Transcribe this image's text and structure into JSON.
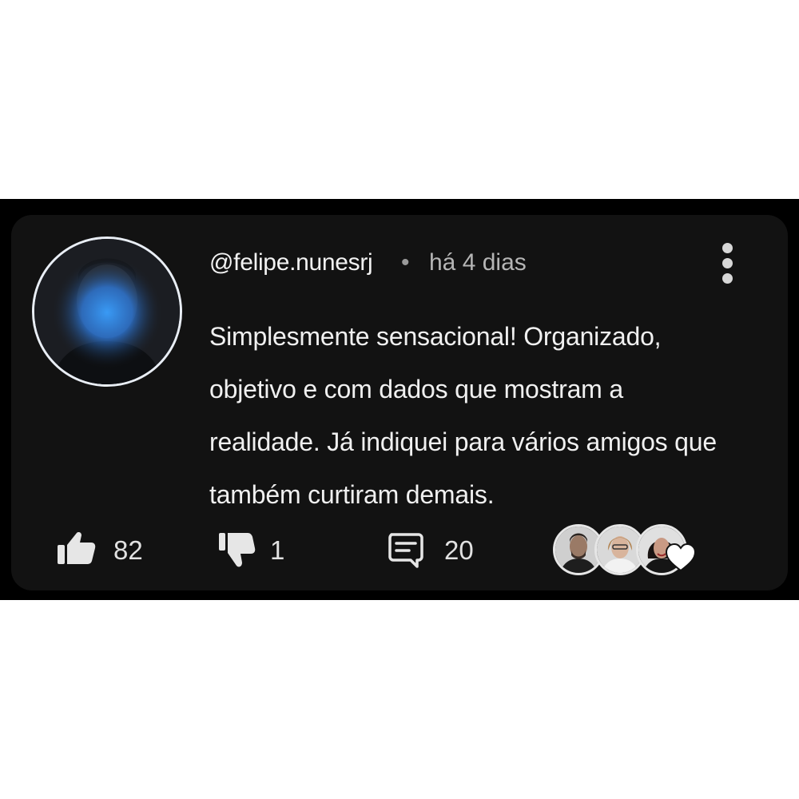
{
  "comment_card": {
    "username": "@felipe.nunesrj",
    "separator": "•",
    "timestamp": "há 4 dias",
    "text": "Simplesmente sensacional! Organizado, objetivo e com dados que mostram a realidade. Já indiquei para vários amigos que também curtiram demais.",
    "likes": "82",
    "dislikes": "1",
    "replies": "20"
  },
  "icons": {
    "like": "thumbs-up-icon",
    "dislike": "thumbs-down-icon",
    "reply": "comment-icon",
    "more": "more-vertical-icon",
    "reaction": "heart-icon"
  },
  "colors": {
    "card_background": "#121212",
    "outer_band": "#000000",
    "text_primary": "#f0f0f0",
    "text_secondary": "#b5b5b5",
    "avatar_glow": "#2f8cff"
  }
}
